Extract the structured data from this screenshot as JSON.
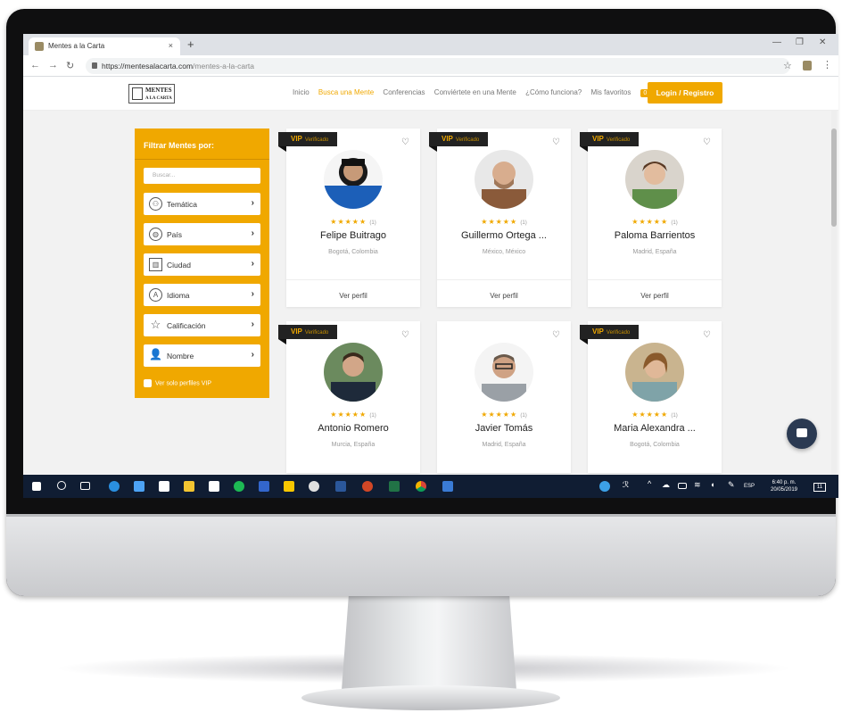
{
  "browser": {
    "tab_title": "Mentes a la Carta",
    "url_host": "https://mentesalacarta.com",
    "url_path": "/mentes-a-la-carta"
  },
  "site": {
    "logo_line1": "MENTES",
    "logo_line2": "A LA CARTA",
    "menu": [
      "Inicio",
      "Busca una Mente",
      "Conferencias",
      "Conviértete en una Mente",
      "¿Cómo funciona?",
      "Mis favoritos"
    ],
    "favorites_count": "0",
    "login_label": "Login / Registro"
  },
  "filter": {
    "title": "Filtrar Mentes por:",
    "search_placeholder": "Buscar...",
    "items": [
      {
        "label": "Temática",
        "icon": "org-chart-icon"
      },
      {
        "label": "País",
        "icon": "globe-icon"
      },
      {
        "label": "Ciudad",
        "icon": "city-icon"
      },
      {
        "label": "Idioma",
        "icon": "language-icon"
      },
      {
        "label": "Calificación",
        "icon": "star-outline-icon"
      },
      {
        "label": "Nombre",
        "icon": "user-search-icon"
      }
    ],
    "vip_only_label": "Ver solo perfiles VIP"
  },
  "cards": [
    {
      "name": "Felipe Buitrago",
      "location": "Bogotá, Colombia",
      "vip": true,
      "rating_count": "(1)",
      "action": "Ver perfil"
    },
    {
      "name": "Guillermo Ortega ...",
      "location": "México, México",
      "vip": true,
      "rating_count": "(1)",
      "action": "Ver perfil"
    },
    {
      "name": "Paloma Barrientos",
      "location": "Madrid, España",
      "vip": true,
      "rating_count": "(1)",
      "action": "Ver perfil"
    },
    {
      "name": "Antonio Romero",
      "location": "Murcia, España",
      "vip": true,
      "rating_count": "(1)"
    },
    {
      "name": "Javier Tomás",
      "location": "Madrid, España",
      "vip": false,
      "rating_count": "(1)"
    },
    {
      "name": "Maria Alexandra ...",
      "location": "Bogotá, Colombia",
      "vip": true,
      "rating_count": "(1)"
    }
  ],
  "vip_badge": {
    "label": "VIP",
    "sub": "Verificado"
  },
  "stars": "★★★★★",
  "taskbar": {
    "language": "ESP",
    "time": "6:40 p. m.",
    "date": "20/05/2019",
    "notifications": "11"
  },
  "colors": {
    "accent": "#f0a800",
    "taskbar": "#101d33",
    "chat": "#2b3a52"
  }
}
